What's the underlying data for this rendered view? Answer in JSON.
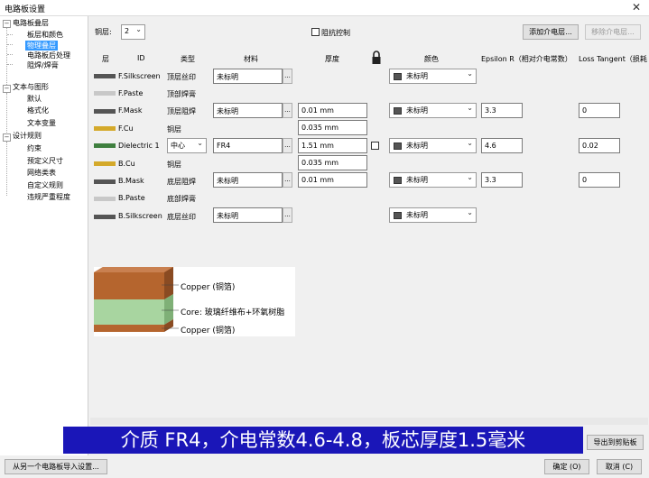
{
  "window": {
    "title": "电路板设置",
    "close": "✕"
  },
  "tree": {
    "root1": "电路板叠层",
    "item_a": "板层和颜色",
    "item_b": "物理叠层",
    "item_c": "电路板后处理",
    "item_d": "阻焊/焊膏",
    "root2": "文本与图形",
    "item_e": "默认",
    "item_f": "格式化",
    "item_g": "文本变量",
    "root3": "设计规则",
    "item_h": "约束",
    "item_i": "预定义尺寸",
    "item_j": "网络类表",
    "item_k": "自定义规则",
    "item_l": "违规严重程度",
    "collapse": "−"
  },
  "toolbar": {
    "layers_label": "铜层:",
    "layers_value": "2",
    "impedance_label": "阻抗控制",
    "add_btn": "添加介电层...",
    "remove_btn": "移除介电层..."
  },
  "headers": {
    "layer": "层",
    "id": "ID",
    "type": "类型",
    "material": "材料",
    "thickness": "厚度",
    "color": "颜色",
    "epsilon": "Epsilon R（相对介电常数）",
    "loss": "Loss Tangent（损耗"
  },
  "rows": [
    {
      "id": "F.Silkscreen",
      "type": "顶层丝印",
      "material": "未标明",
      "color": "未标明",
      "swatch": "#555555"
    },
    {
      "id": "F.Paste",
      "type": "顶部焊膏",
      "swatch": "#c8c8c8"
    },
    {
      "id": "F.Mask",
      "type": "顶层阻焊",
      "material": "未标明",
      "thickness": "0.01 mm",
      "color": "未标明",
      "epsilon": "3.3",
      "loss": "0",
      "swatch": "#555555"
    },
    {
      "id": "F.Cu",
      "type": "铜层",
      "thickness": "0.035 mm",
      "swatch": "#d4a92a"
    },
    {
      "id": "Dielectric 1",
      "type": "中心",
      "material": "FR4",
      "thickness": "1.51 mm",
      "color": "未标明",
      "epsilon": "4.6",
      "loss": "0.02",
      "swatch": "#3f7f3f"
    },
    {
      "id": "B.Cu",
      "type": "铜层",
      "thickness": "0.035 mm",
      "swatch": "#d4a92a"
    },
    {
      "id": "B.Mask",
      "type": "底层阻焊",
      "material": "未标明",
      "thickness": "0.01 mm",
      "color": "未标明",
      "epsilon": "3.3",
      "loss": "0",
      "swatch": "#555555"
    },
    {
      "id": "B.Paste",
      "type": "底部焊膏",
      "swatch": "#c8c8c8"
    },
    {
      "id": "B.Silkscreen",
      "type": "底层丝印",
      "material": "未标明",
      "color": "未标明",
      "swatch": "#555555"
    }
  ],
  "illustration": {
    "label1": "Copper (铜箔)",
    "label2": "Core: 玻璃纤维布+环氧树脂",
    "label3": "Copper (铜箔)",
    "copper_color": "#b5652e",
    "core_color": "#a8d5a0"
  },
  "subtitle": "介质 FR4，介电常数4.6-4.8，板芯厚度1.5毫米",
  "footer": {
    "import_btn": "从另一个电路板导入设置...",
    "export_btn": "导出到剪贴板",
    "ok_btn": "确定 (O)",
    "cancel_btn": "取消 (C)"
  }
}
